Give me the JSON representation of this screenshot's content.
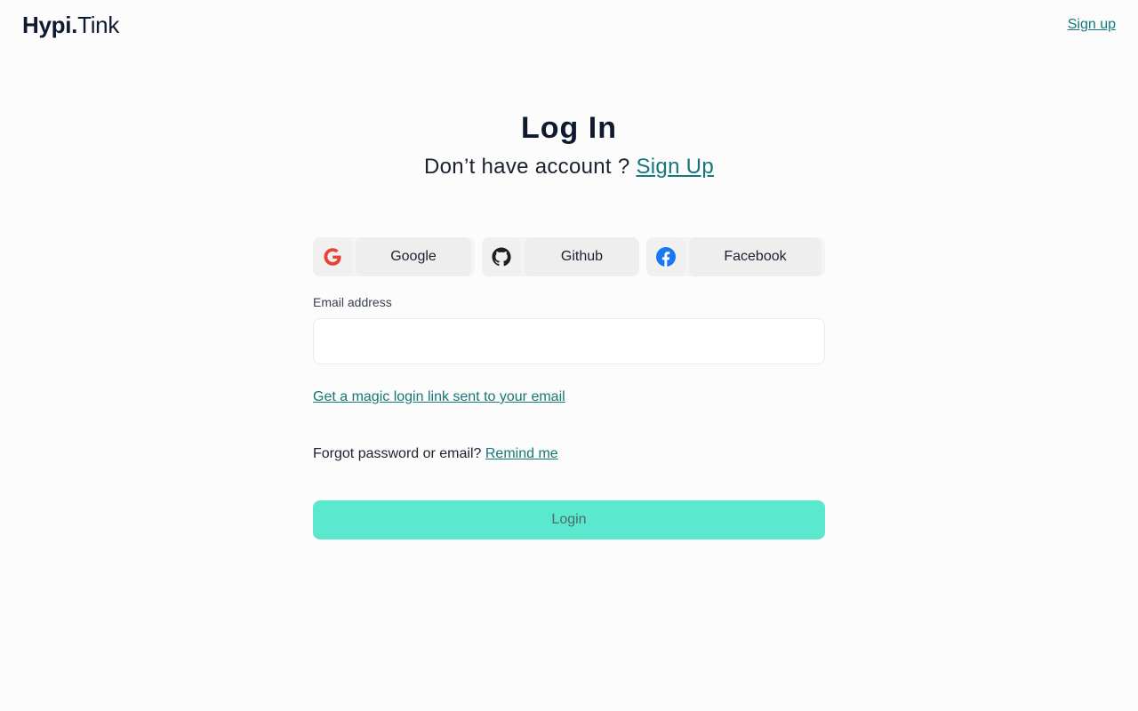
{
  "header": {
    "logo_bold": "Hypi.",
    "logo_light": "Tink",
    "signup_link": "Sign up"
  },
  "main": {
    "title": "Log In",
    "subtitle_text": "Don’t have account ?",
    "subtitle_link": "Sign Up"
  },
  "social": {
    "google": {
      "label": "Google",
      "icon": "google-icon"
    },
    "github": {
      "label": "Github",
      "icon": "github-icon"
    },
    "facebook": {
      "label": "Facebook",
      "icon": "facebook-icon"
    }
  },
  "form": {
    "email_label": "Email address",
    "email_value": "",
    "email_placeholder": "",
    "magic_link": "Get a magic login link sent to your email",
    "forgot_text": "Forgot password or email?",
    "forgot_link": "Remind me",
    "login_label": "Login"
  },
  "colors": {
    "accent": "#14777a",
    "login_button": "#5ae8cf",
    "google_red": "#ea4335",
    "facebook_blue": "#1877f2"
  }
}
